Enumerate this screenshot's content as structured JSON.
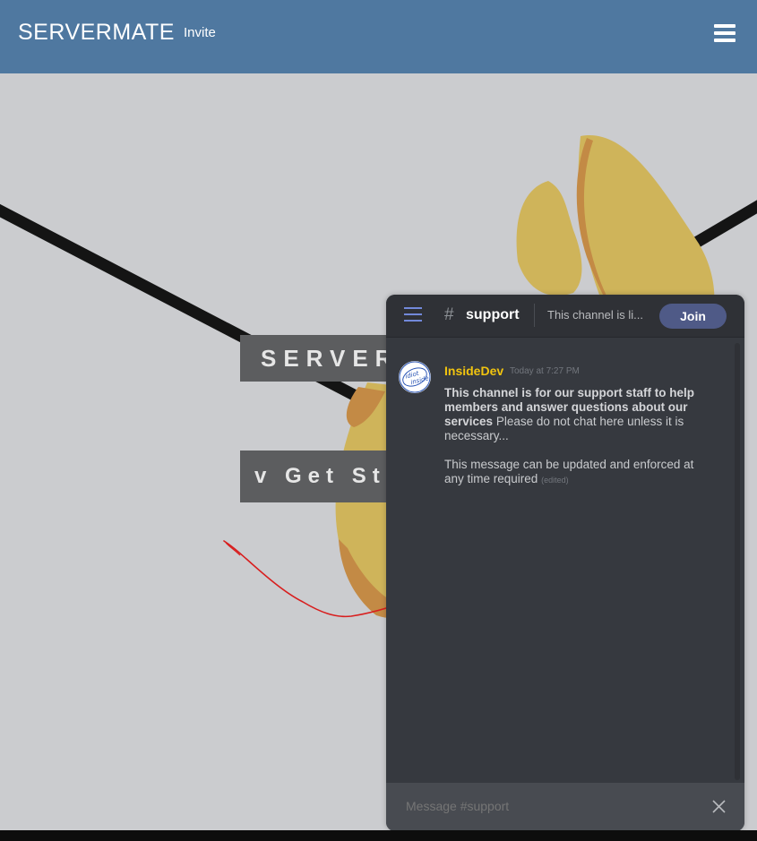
{
  "navbar": {
    "brand": "SERVERMATE",
    "invite_label": "Invite",
    "menu_icon": "hamburger-icon",
    "bg_color": "#4f78a0"
  },
  "hero": {
    "title": "SERVERMATE",
    "cta_label": "v Get Started"
  },
  "widget": {
    "channel": {
      "hash": "#",
      "name": "support",
      "topic": "This channel is li..."
    },
    "join_label": "Join",
    "messages": [
      {
        "author": "InsideDev",
        "author_color": "#f1c40f",
        "time": "Today at 7:27 PM",
        "bold": "This channel is for our support staff to help members and answer questions about our services",
        "text": " Please do not chat here unless it is necessary...",
        "text2": "This message can be updated and enforced at any time required",
        "edited": "(edited)",
        "avatar_text_1": "idiot",
        "avatar_text_2": "inside"
      }
    ],
    "composer": {
      "placeholder": "Message #support"
    },
    "accent": "#7289da"
  }
}
